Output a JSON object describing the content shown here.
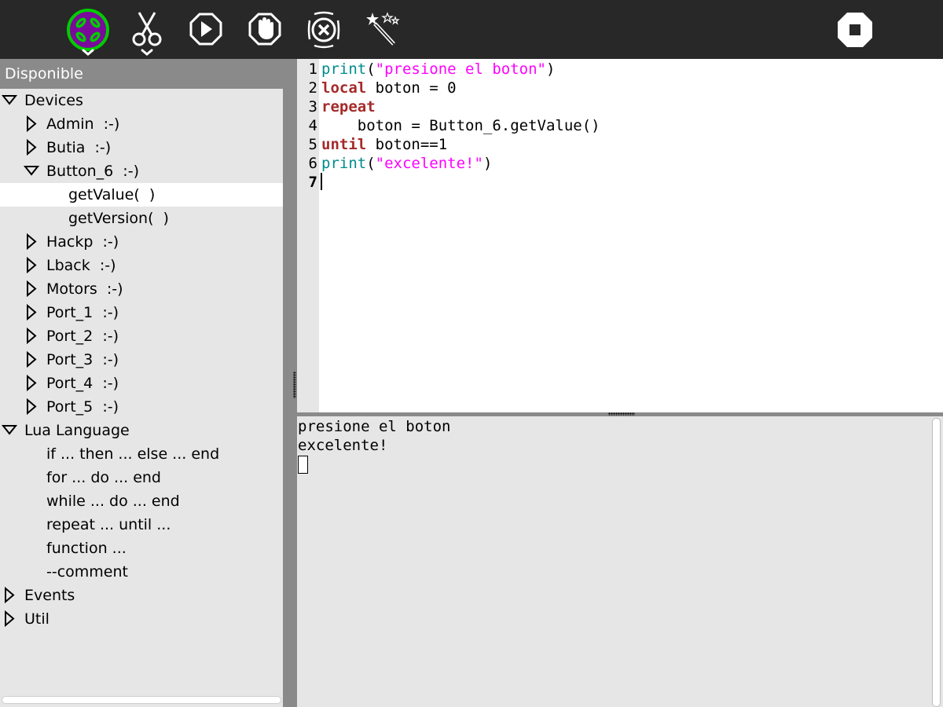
{
  "toolbar": {
    "buttons": [
      {
        "name": "activity",
        "icon": "butia-activity-icon"
      },
      {
        "name": "edit",
        "icon": "scissors-icon"
      },
      {
        "name": "run",
        "icon": "play-icon"
      },
      {
        "name": "stop",
        "icon": "hand-stop-icon"
      },
      {
        "name": "clear",
        "icon": "clear-x-icon"
      },
      {
        "name": "magic",
        "icon": "magic-wand-icon"
      },
      {
        "name": "quit",
        "icon": "stop-square-icon"
      }
    ],
    "colors": {
      "background": "#282828",
      "accent_green": "#00cc00",
      "accent_purple": "#7a0a9a"
    }
  },
  "sidebar": {
    "header": "Disponible",
    "items": [
      {
        "label": "Devices",
        "expanded": true
      },
      {
        "label": "Admin  :-)",
        "expanded": false
      },
      {
        "label": "Butia  :-)",
        "expanded": false
      },
      {
        "label": "Button_6  :-)",
        "expanded": true
      },
      {
        "label": "getValue(  )",
        "selected": true
      },
      {
        "label": "getVersion(  )"
      },
      {
        "label": "Hackp  :-)",
        "expanded": false
      },
      {
        "label": "Lback  :-)",
        "expanded": false
      },
      {
        "label": "Motors  :-)",
        "expanded": false
      },
      {
        "label": "Port_1  :-)",
        "expanded": false
      },
      {
        "label": "Port_2  :-)",
        "expanded": false
      },
      {
        "label": "Port_3  :-)",
        "expanded": false
      },
      {
        "label": "Port_4  :-)",
        "expanded": false
      },
      {
        "label": "Port_5  :-)",
        "expanded": false
      },
      {
        "label": "Lua Language",
        "expanded": true
      },
      {
        "label": "if ... then ... else ... end"
      },
      {
        "label": "for ... do ... end"
      },
      {
        "label": "while ... do ... end"
      },
      {
        "label": "repeat ... until ..."
      },
      {
        "label": "function ..."
      },
      {
        "label": "--comment"
      },
      {
        "label": "Events",
        "expanded": false
      },
      {
        "label": "Util",
        "expanded": false
      }
    ]
  },
  "editor": {
    "line_numbers": [
      "1",
      "2",
      "3",
      "4",
      "5",
      "6",
      "7"
    ],
    "current_line": "7",
    "lines": [
      {
        "tokens": [
          [
            "fn",
            "print"
          ],
          [
            "",
            "("
          ],
          [
            "str",
            "\"presione el boton\""
          ],
          [
            "",
            ")"
          ]
        ]
      },
      {
        "tokens": [
          [
            "kw",
            "local"
          ],
          [
            "",
            " boton = 0"
          ]
        ]
      },
      {
        "tokens": [
          [
            "kw",
            "repeat"
          ]
        ]
      },
      {
        "tokens": [
          [
            "",
            "    boton = Button_6.getValue()"
          ]
        ]
      },
      {
        "tokens": [
          [
            "kw",
            "until"
          ],
          [
            "",
            " boton==1"
          ]
        ]
      },
      {
        "tokens": [
          [
            "fn",
            "print"
          ],
          [
            "",
            "("
          ],
          [
            "str",
            "\"excelente!\""
          ],
          [
            "",
            ")"
          ]
        ]
      },
      {
        "tokens": []
      }
    ],
    "colors": {
      "keyword": "#a52a2a",
      "function": "#008b8b",
      "string": "#ff00ff"
    }
  },
  "console": {
    "output": [
      "presione el boton",
      "excelente!"
    ]
  }
}
